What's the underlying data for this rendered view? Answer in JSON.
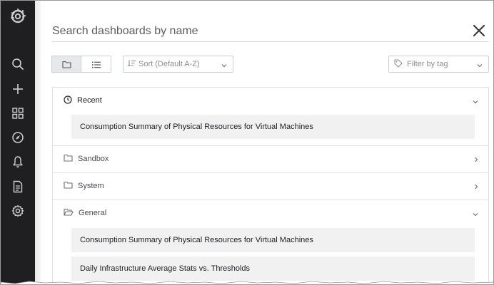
{
  "search": {
    "placeholder": "Search dashboards by name"
  },
  "toolbar": {
    "view_folders_icon": "folder-icon",
    "view_list_icon": "list-icon",
    "sort": {
      "selected": "Sort (Default A-Z)"
    },
    "tag_filter": {
      "placeholder": "Filter by tag"
    }
  },
  "sidebar": {
    "items": [
      {
        "icon": "search-icon"
      },
      {
        "icon": "plus-icon"
      },
      {
        "icon": "dashboards-grid-icon"
      },
      {
        "icon": "compass-icon"
      },
      {
        "icon": "bell-icon"
      },
      {
        "icon": "document-icon"
      },
      {
        "icon": "gear-icon"
      }
    ]
  },
  "sections": [
    {
      "label": "Recent",
      "icon": "clock-icon",
      "expanded": true,
      "items": [
        "Consumption Summary of Physical Resources for Virtual Machines"
      ]
    },
    {
      "label": "Sandbox",
      "icon": "folder-icon",
      "expanded": false,
      "items": []
    },
    {
      "label": "System",
      "icon": "folder-icon",
      "expanded": false,
      "items": []
    },
    {
      "label": "General",
      "icon": "folder-open-icon",
      "expanded": true,
      "items": [
        "Consumption Summary of Physical Resources for Virtual Machines",
        "Daily Infrastructure Average Stats vs. Thresholds"
      ]
    }
  ],
  "colors": {
    "rail": "#1f1f21",
    "text": "#464c54",
    "item_bg": "#f1f1f2",
    "border": "#e0e1e4"
  }
}
